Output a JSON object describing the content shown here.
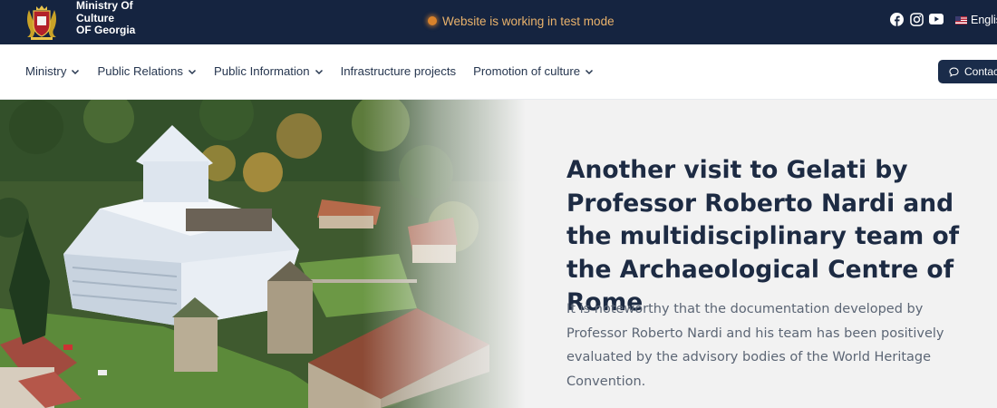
{
  "header": {
    "logo_lines": [
      "Ministry Of",
      "Culture",
      "OF Georgia"
    ],
    "test_mode_text": "Website is working in test mode",
    "social_icons": [
      "facebook-icon",
      "instagram-icon",
      "youtube-icon"
    ],
    "language": "English"
  },
  "nav": {
    "items": [
      {
        "label": "Ministry",
        "dropdown": true
      },
      {
        "label": "Public Relations",
        "dropdown": true
      },
      {
        "label": "Public Information",
        "dropdown": true
      },
      {
        "label": "Infrastructure projects",
        "dropdown": false
      },
      {
        "label": "Promotion of culture",
        "dropdown": true
      }
    ],
    "contact_label": "Contact"
  },
  "hero": {
    "title": "Another visit to Gelati by Professor Roberto Nardi and the multidisciplinary team of the Archaeological Centre of Rome",
    "description": "It is noteworthy that the documentation developed by Professor Roberto Nardi and his team has been positively evaluated by the advisory bodies of the World Heritage Convention."
  },
  "colors": {
    "topbar_bg": "#152440",
    "accent_orange": "#d9822b",
    "contact_bg": "#1a2c4a",
    "title_text": "#1d2b43"
  }
}
